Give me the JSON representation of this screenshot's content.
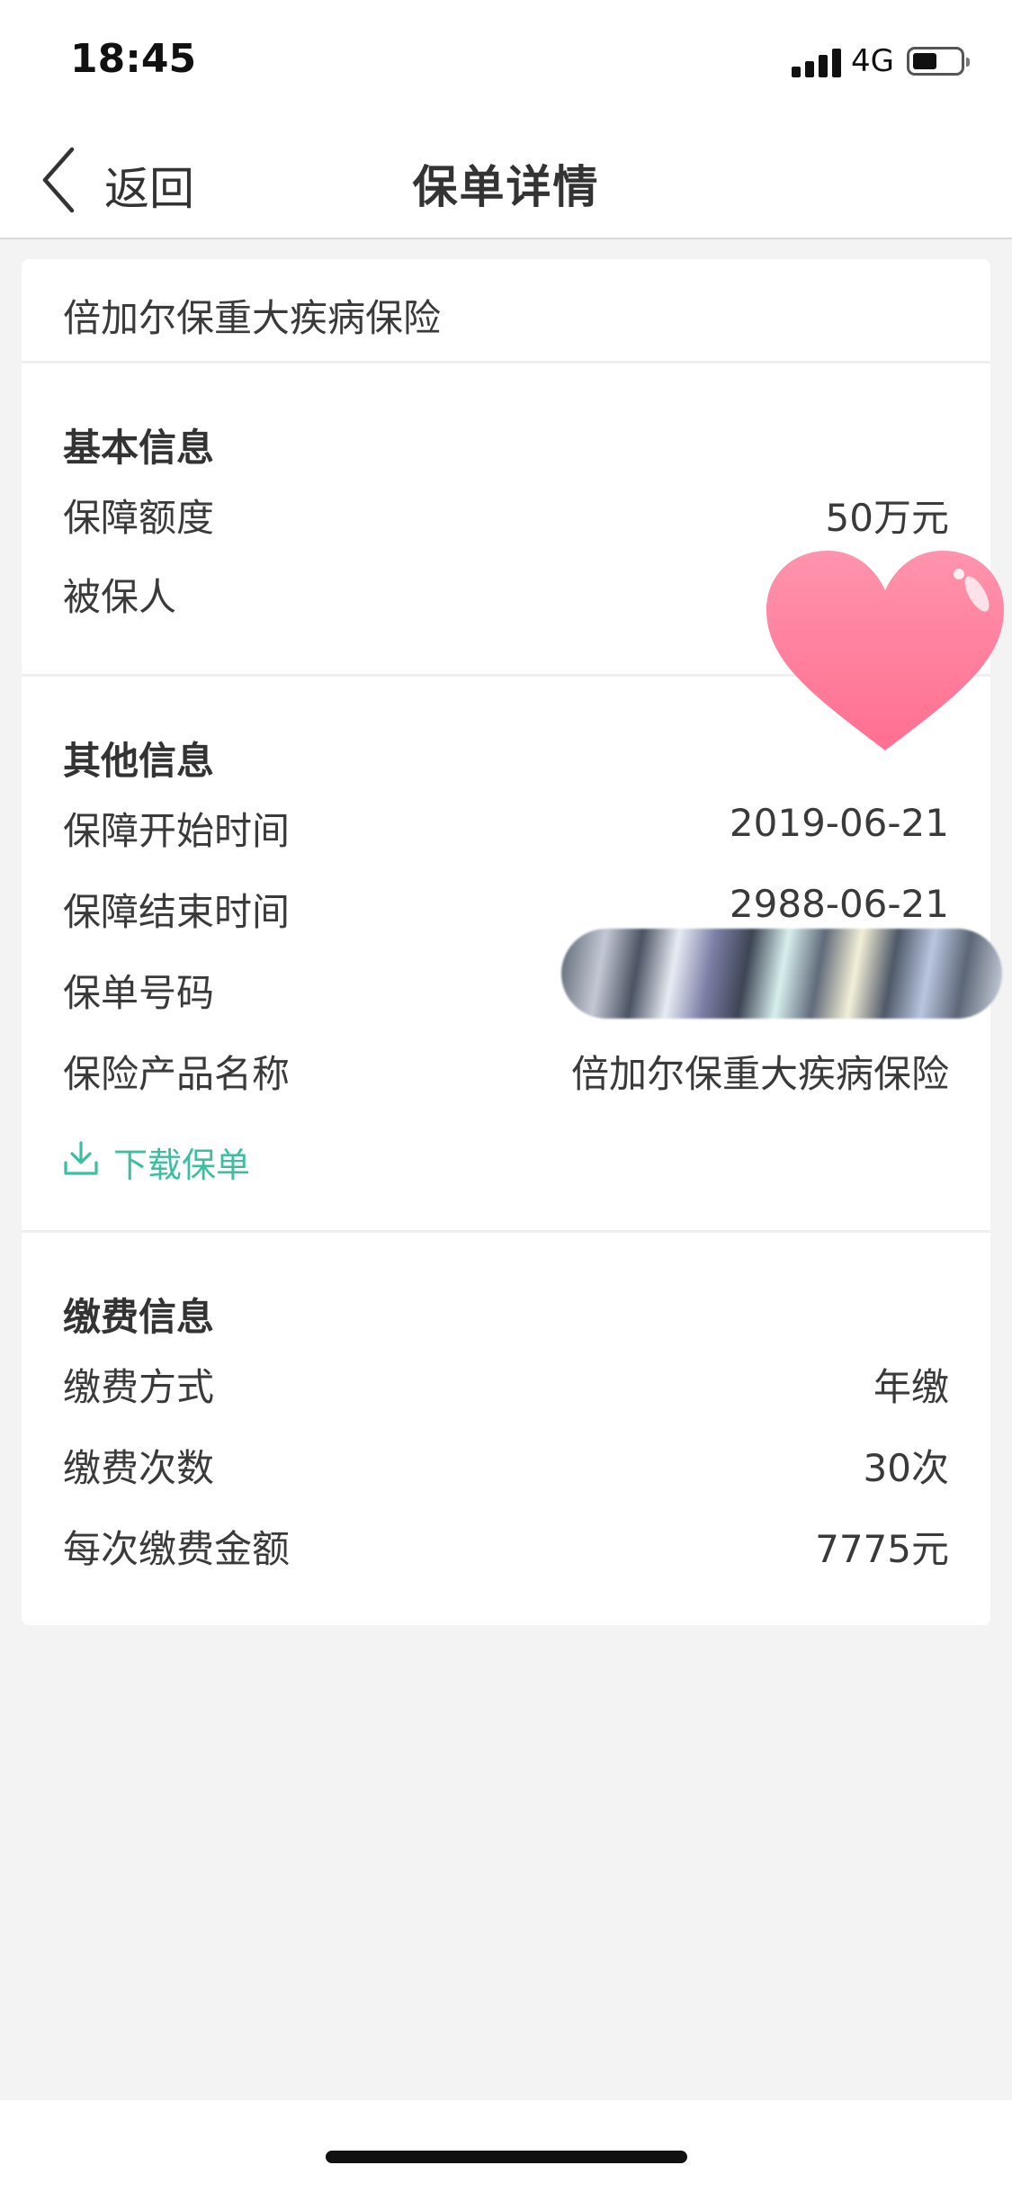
{
  "status_bar": {
    "time": "18:45",
    "network": "4G",
    "icons": [
      "signal-icon",
      "battery-icon"
    ]
  },
  "nav": {
    "back_label": "返回",
    "title": "保单详情",
    "back_icon": "chevron-left-icon"
  },
  "policy": {
    "name": "倍加尔保重大疾病保险"
  },
  "basic_info": {
    "title": "基本信息",
    "rows": [
      {
        "label": "保障额度",
        "value": "50万元"
      },
      {
        "label": "被保人",
        "value": ""
      }
    ]
  },
  "other_info": {
    "title": "其他信息",
    "rows": [
      {
        "label": "保障开始时间",
        "value": "2019-06-21"
      },
      {
        "label": "保障结束时间",
        "value": "2988-06-21"
      },
      {
        "label": "保单号码",
        "value": ""
      },
      {
        "label": "保险产品名称",
        "value": "倍加尔保重大疾病保险"
      }
    ],
    "download_label": "下载保单",
    "download_icon": "download-icon"
  },
  "payment_info": {
    "title": "缴费信息",
    "rows": [
      {
        "label": "缴费方式",
        "value": "年缴"
      },
      {
        "label": "缴费次数",
        "value": "30次"
      },
      {
        "label": "每次缴费金额",
        "value": "7775元"
      }
    ]
  },
  "colors": {
    "accent": "#3cbfa0",
    "background": "#f3f3f4",
    "card": "#ffffff",
    "heart": "#ff7fa0"
  }
}
